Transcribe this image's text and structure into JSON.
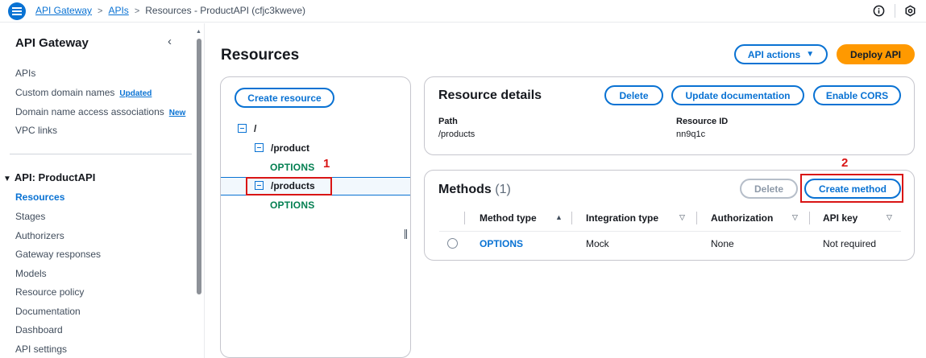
{
  "breadcrumb": {
    "home": "API Gateway",
    "apis": "APIs",
    "current": "Resources - ProductAPI (cfjc3kweve)"
  },
  "icons": {
    "menu": "hamburger-icon",
    "info": "info-icon",
    "settings": "gear-icon"
  },
  "sidebar": {
    "title": "API Gateway",
    "items": [
      {
        "label": "APIs"
      },
      {
        "label": "Custom domain names",
        "badge": "Updated"
      },
      {
        "label": "Domain name access associations",
        "badge": "New"
      },
      {
        "label": "VPC links"
      }
    ],
    "section": "API: ProductAPI",
    "section_items": [
      {
        "label": "Resources",
        "active": true
      },
      {
        "label": "Stages"
      },
      {
        "label": "Authorizers"
      },
      {
        "label": "Gateway responses"
      },
      {
        "label": "Models"
      },
      {
        "label": "Resource policy"
      },
      {
        "label": "Documentation"
      },
      {
        "label": "Dashboard"
      },
      {
        "label": "API settings"
      }
    ]
  },
  "header": {
    "title": "Resources",
    "api_actions": "API actions",
    "deploy": "Deploy API"
  },
  "tree": {
    "create_resource": "Create resource",
    "nodes": [
      {
        "path": "/"
      },
      {
        "path": "/product",
        "method": "OPTIONS"
      },
      {
        "path": "/products",
        "method": "OPTIONS",
        "selected": true
      }
    ]
  },
  "annotations": {
    "one": "1",
    "two": "2",
    "color": "#d91515"
  },
  "resource_details": {
    "title": "Resource details",
    "delete": "Delete",
    "update_docs": "Update documentation",
    "enable_cors": "Enable CORS",
    "path_label": "Path",
    "path_value": "/products",
    "id_label": "Resource ID",
    "id_value": "nn9q1c"
  },
  "methods": {
    "title": "Methods",
    "count": "(1)",
    "delete": "Delete",
    "create": "Create method",
    "columns": [
      "Method type",
      "Integration type",
      "Authorization",
      "API key"
    ],
    "rows": [
      {
        "method": "OPTIONS",
        "integration": "Mock",
        "authorization": "None",
        "api_key": "Not required"
      }
    ]
  },
  "colors": {
    "link": "#0972d3",
    "accent": "#ff9900",
    "method_green": "#037f51"
  }
}
